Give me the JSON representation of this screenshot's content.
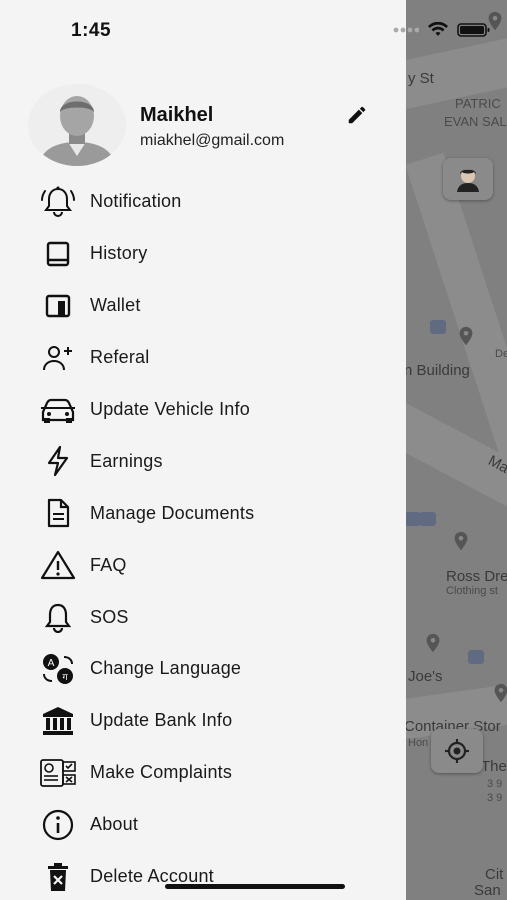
{
  "status_bar": {
    "time": "1:45"
  },
  "profile": {
    "name": "Maikhel",
    "email": "miakhel@gmail.com"
  },
  "menu": [
    {
      "label": "Notification",
      "icon": "bell-ringing-icon"
    },
    {
      "label": "History",
      "icon": "book-icon"
    },
    {
      "label": "Wallet",
      "icon": "wallet-icon"
    },
    {
      "label": "Referal",
      "icon": "add-person-icon"
    },
    {
      "label": "Update Vehicle Info",
      "icon": "car-icon"
    },
    {
      "label": "Earnings",
      "icon": "lightning-icon"
    },
    {
      "label": "Manage Documents",
      "icon": "document-icon"
    },
    {
      "label": "FAQ",
      "icon": "warning-icon"
    },
    {
      "label": "SOS",
      "icon": "bell-icon"
    },
    {
      "label": "Change Language",
      "icon": "translate-icon"
    },
    {
      "label": "Update Bank Info",
      "icon": "bank-icon"
    },
    {
      "label": "Make Complaints",
      "icon": "complaint-icon"
    },
    {
      "label": "About",
      "icon": "info-icon"
    },
    {
      "label": "Delete Account",
      "icon": "trash-icon"
    }
  ],
  "map": {
    "labels": [
      "y St",
      "PATRIC",
      "EVAN SALO",
      "n Building",
      "De",
      "Ma",
      "Ross Dre",
      "Clothing st",
      "Joe's",
      "Container Stor",
      "Hon",
      "The",
      "3 9",
      "3 9",
      "Cit",
      "San"
    ]
  }
}
